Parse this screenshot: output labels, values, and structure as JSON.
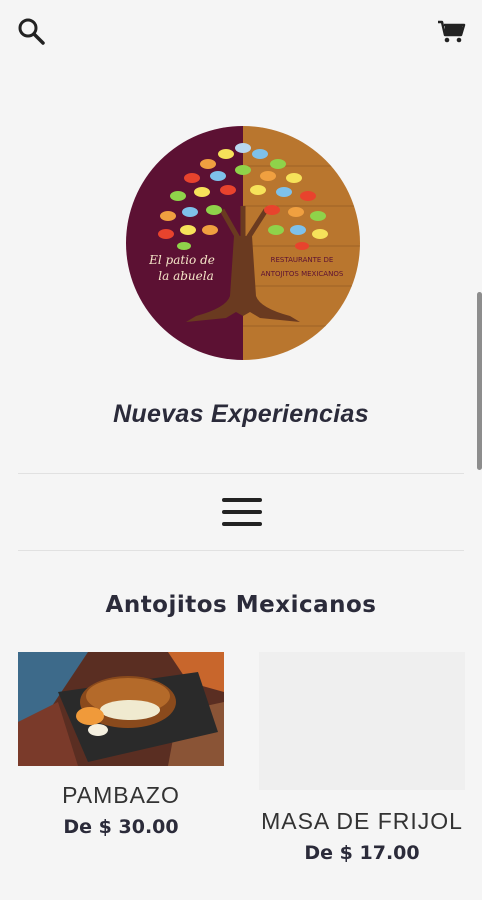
{
  "header": {
    "search_icon": "search-icon",
    "cart_icon": "cart-icon"
  },
  "logo": {
    "left_text": "El patio de la abuela",
    "right_text": "Restaurante de antojitos mexicanos"
  },
  "store": {
    "name": "Nuevas Experiencias"
  },
  "nav": {
    "menu_icon": "hamburger-menu-icon"
  },
  "section": {
    "title": "Antojitos Mexicanos"
  },
  "products": [
    {
      "name": "PAMBAZO",
      "price": "De $ 30.00"
    },
    {
      "name": "MASA DE FRIJOL",
      "price": "De $ 17.00"
    }
  ],
  "colors": {
    "background": "#f5f5f5",
    "logo_left": "#5c1133",
    "logo_right": "#b9762e",
    "text_dark": "#2b2b3a"
  }
}
